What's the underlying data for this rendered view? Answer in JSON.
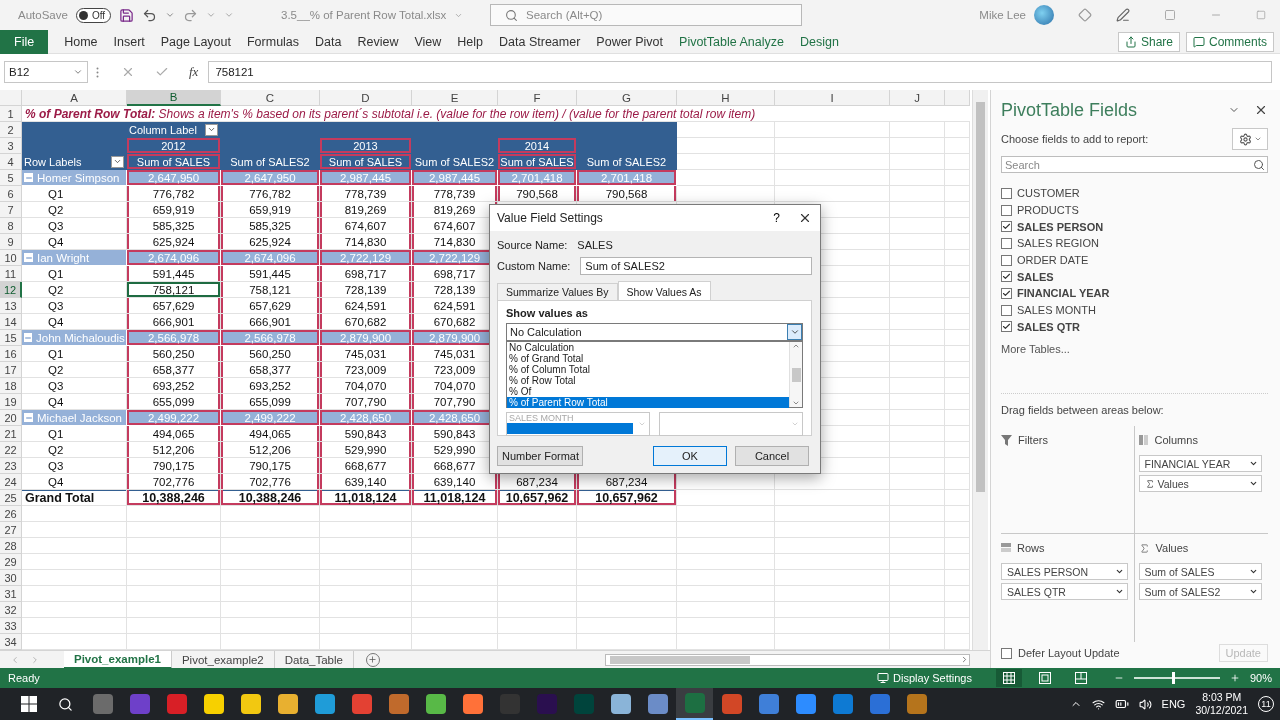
{
  "title_bar": {
    "autosave_label": "AutoSave",
    "autosave_state": "Off",
    "autosave_on": false,
    "file_name": "3.5__% of Parent Row Total.xlsx",
    "search_placeholder": "Search (Alt+Q)",
    "user_name": "Mike Lee"
  },
  "ribbon": {
    "tabs": [
      {
        "label": "File",
        "kind": "file"
      },
      {
        "label": "Home",
        "kind": "normal"
      },
      {
        "label": "Insert",
        "kind": "normal"
      },
      {
        "label": "Page Layout",
        "kind": "normal"
      },
      {
        "label": "Formulas",
        "kind": "normal"
      },
      {
        "label": "Data",
        "kind": "normal"
      },
      {
        "label": "Review",
        "kind": "normal"
      },
      {
        "label": "View",
        "kind": "normal"
      },
      {
        "label": "Help",
        "kind": "normal"
      },
      {
        "label": "Data Streamer",
        "kind": "normal"
      },
      {
        "label": "Power Pivot",
        "kind": "normal"
      },
      {
        "label": "PivotTable Analyze",
        "kind": "contextual"
      },
      {
        "label": "Design",
        "kind": "contextual"
      }
    ],
    "share": "Share",
    "comments": "Comments"
  },
  "formula_bar": {
    "name_box": "B12",
    "fx": "fx",
    "value": "758121"
  },
  "sheet": {
    "columns": [
      {
        "label": "A",
        "selected": false
      },
      {
        "label": "B",
        "selected": true
      },
      {
        "label": "C",
        "selected": false
      },
      {
        "label": "D",
        "selected": false
      },
      {
        "label": "E",
        "selected": false
      },
      {
        "label": "F",
        "selected": false
      },
      {
        "label": "G",
        "selected": false
      },
      {
        "label": "H",
        "selected": false
      },
      {
        "label": "I",
        "selected": false
      },
      {
        "label": "J",
        "selected": false
      }
    ],
    "row_numbers": [
      "1",
      "2",
      "3",
      "4",
      "5",
      "6",
      "7",
      "8",
      "9",
      "10",
      "11",
      "12",
      "13",
      "14",
      "15",
      "16",
      "17",
      "18",
      "19",
      "20",
      "21",
      "22",
      "23",
      "24",
      "25",
      "26",
      "27",
      "28",
      "29",
      "30",
      "31",
      "32",
      "33",
      "34"
    ],
    "note": "**% of Parent Row Total:**  Shows a item's % based on its parent´s subtotal i.e. (value for the row item) / (value for the parent total row item)",
    "pivot": {
      "column_labels": "Column Label",
      "row_labels": "Row Labels",
      "years": [
        "2012",
        "2013",
        "2014"
      ],
      "value_headers": [
        "Sum of SALES",
        "Sum of SALES2",
        "Sum of SALES",
        "Sum of SALES2",
        "Sum of SALES",
        "Sum of SALES2"
      ],
      "groups": [
        {
          "name": "Homer Simpson",
          "expanded": true,
          "totals": [
            "2,647,950",
            "2,647,950",
            "2,987,445",
            "2,987,445",
            "2,701,418",
            "2,701,418"
          ],
          "quarters": [
            {
              "label": "Q1",
              "selected": false,
              "values": [
                "776,782",
                "776,782",
                "778,739",
                "778,739",
                "790,568",
                "790,568"
              ]
            },
            {
              "label": "Q2",
              "selected": false,
              "values": [
                "659,919",
                "659,919",
                "819,269",
                "819,269"
              ]
            },
            {
              "label": "Q3",
              "selected": false,
              "values": [
                "585,325",
                "585,325",
                "674,607",
                "674,607"
              ]
            },
            {
              "label": "Q4",
              "selected": false,
              "values": [
                "625,924",
                "625,924",
                "714,830",
                "714,830"
              ]
            }
          ]
        },
        {
          "name": "Ian Wright",
          "expanded": true,
          "totals": [
            "2,674,096",
            "2,674,096",
            "2,722,129",
            "2,722,129"
          ],
          "quarters": [
            {
              "label": "Q1",
              "selected": false,
              "values": [
                "591,445",
                "591,445",
                "698,717",
                "698,717"
              ]
            },
            {
              "label": "Q2",
              "selected": true,
              "values": [
                "758,121",
                "758,121",
                "728,139",
                "728,139"
              ]
            },
            {
              "label": "Q3",
              "selected": false,
              "values": [
                "657,629",
                "657,629",
                "624,591",
                "624,591"
              ]
            },
            {
              "label": "Q4",
              "selected": false,
              "values": [
                "666,901",
                "666,901",
                "670,682",
                "670,682"
              ]
            }
          ]
        },
        {
          "name": "John Michaloudis",
          "expanded": true,
          "totals": [
            "2,566,978",
            "2,566,978",
            "2,879,900",
            "2,879,900"
          ],
          "quarters": [
            {
              "label": "Q1",
              "selected": false,
              "values": [
                "560,250",
                "560,250",
                "745,031",
                "745,031"
              ]
            },
            {
              "label": "Q2",
              "selected": false,
              "values": [
                "658,377",
                "658,377",
                "723,009",
                "723,009"
              ]
            },
            {
              "label": "Q3",
              "selected": false,
              "values": [
                "693,252",
                "693,252",
                "704,070",
                "704,070"
              ]
            },
            {
              "label": "Q4",
              "selected": false,
              "values": [
                "655,099",
                "655,099",
                "707,790",
                "707,790"
              ]
            }
          ]
        },
        {
          "name": "Michael Jackson",
          "expanded": true,
          "totals": [
            "2,499,222",
            "2,499,222",
            "2,428,650",
            "2,428,650"
          ],
          "quarters": [
            {
              "label": "Q1",
              "selected": false,
              "values": [
                "494,065",
                "494,065",
                "590,843",
                "590,843"
              ]
            },
            {
              "label": "Q2",
              "selected": false,
              "values": [
                "512,206",
                "512,206",
                "529,990",
                "529,990"
              ]
            },
            {
              "label": "Q3",
              "selected": false,
              "values": [
                "790,175",
                "790,175",
                "668,677",
                "668,677"
              ]
            },
            {
              "label": "Q4",
              "selected": false,
              "values": [
                "702,776",
                "702,776",
                "639,140",
                "639,140",
                "687,234",
                "687,234"
              ]
            }
          ]
        }
      ],
      "grand_total": {
        "label": "Grand Total",
        "values": [
          "10,388,246",
          "10,388,246",
          "11,018,124",
          "11,018,124",
          "10,657,962",
          "10,657,962"
        ]
      }
    }
  },
  "dialog": {
    "title": "Value Field Settings",
    "help": "?",
    "source_label": "Source Name:",
    "source_value": "SALES",
    "custom_label": "Custom Name:",
    "custom_value": "Sum of SALES2",
    "tabs": [
      {
        "label": "Summarize Values By",
        "selected": false
      },
      {
        "label": "Show Values As",
        "selected": true
      }
    ],
    "section_label": "Show values as",
    "dropdown_value": "No Calculation",
    "options": [
      {
        "label": "No Calculation",
        "selected": false
      },
      {
        "label": "% of Grand Total",
        "selected": false
      },
      {
        "label": "% of Column Total",
        "selected": false
      },
      {
        "label": "% of Row Total",
        "selected": false
      },
      {
        "label": "% Of",
        "selected": false
      },
      {
        "label": "% of Parent Row Total",
        "selected": true
      }
    ],
    "base_field_item": "SALES MONTH",
    "buttons": [
      {
        "label": "Number Format",
        "kind": "secondary"
      },
      {
        "label": "OK",
        "kind": "default"
      },
      {
        "label": "Cancel",
        "kind": "secondary"
      }
    ]
  },
  "pane": {
    "title": "PivotTable Fields",
    "subtitle": "Choose fields to add to report:",
    "search_placeholder": "Search",
    "fields": [
      {
        "label": "CUSTOMER",
        "checked": false
      },
      {
        "label": "PRODUCTS",
        "checked": false
      },
      {
        "label": "SALES PERSON",
        "checked": true
      },
      {
        "label": "SALES REGION",
        "checked": false
      },
      {
        "label": "ORDER DATE",
        "checked": false
      },
      {
        "label": "SALES",
        "checked": true
      },
      {
        "label": "FINANCIAL YEAR",
        "checked": true
      },
      {
        "label": "SALES MONTH",
        "checked": false
      },
      {
        "label": "SALES QTR",
        "checked": true
      }
    ],
    "more_tables": "More Tables...",
    "drag_hint": "Drag fields between areas below:",
    "areas": [
      {
        "title": "Filters",
        "kind": "filters"
      },
      {
        "title": "Columns",
        "kind": "columns",
        "items": [
          {
            "label": "FINANCIAL YEAR",
            "kind": "field"
          },
          {
            "label": "Values",
            "kind": "values"
          }
        ]
      },
      {
        "title": "Rows",
        "kind": "rows",
        "items": [
          {
            "label": "SALES PERSON",
            "kind": "field"
          },
          {
            "label": "SALES QTR",
            "kind": "field"
          }
        ]
      },
      {
        "title": "Values",
        "kind": "values",
        "items": [
          {
            "label": "Sum of SALES",
            "kind": "field"
          },
          {
            "label": "Sum of SALES2",
            "kind": "field"
          }
        ]
      }
    ],
    "defer_label": "Defer Layout Update",
    "defer_checked": false,
    "update": "Update",
    "update_disabled": true
  },
  "sheet_tabs": {
    "tabs": [
      {
        "label": "Pivot_example1",
        "selected": true
      },
      {
        "label": "Pivot_example2",
        "selected": false
      },
      {
        "label": "Data_Table",
        "selected": false
      }
    ]
  },
  "status_bar": {
    "status": "Ready",
    "display_settings": "Display Settings",
    "views": [
      {
        "kind": "normal",
        "selected": true
      },
      {
        "kind": "page_layout",
        "selected": false
      },
      {
        "kind": "page_break",
        "selected": false
      }
    ],
    "zoom": {
      "level": 0.45,
      "reading": "90%"
    }
  },
  "taskbar": {
    "apps": [
      {
        "color": "#6b6b6b",
        "active": false
      },
      {
        "color": "#6e40c9",
        "active": false
      },
      {
        "color": "#d81f26",
        "active": false
      },
      {
        "color": "#f7d000",
        "active": false
      },
      {
        "color": "#f2c811",
        "active": false
      },
      {
        "color": "#e8b030",
        "active": false
      },
      {
        "color": "#1f9cd8",
        "active": false
      },
      {
        "color": "#e34133",
        "active": false
      },
      {
        "color": "#c06a2c",
        "active": false
      },
      {
        "color": "#58b947",
        "active": false
      },
      {
        "color": "#ff7139",
        "active": false
      },
      {
        "color": "#333333",
        "active": false
      },
      {
        "color": "#2a0f4f",
        "active": false
      },
      {
        "color": "#00443c",
        "active": false
      },
      {
        "color": "#8ab4d8",
        "active": false
      },
      {
        "color": "#6b8cc7",
        "active": false
      },
      {
        "color": "#1d6f42",
        "active": true
      },
      {
        "color": "#d24726",
        "active": false
      },
      {
        "color": "#3f7fd8",
        "active": false
      },
      {
        "color": "#2d8cff",
        "active": false
      },
      {
        "color": "#0e7ad3",
        "active": false
      },
      {
        "color": "#2b6fd6",
        "active": false
      },
      {
        "color": "#b5741c",
        "active": false
      }
    ],
    "language": "ENG",
    "time": "8:03 PM",
    "date": "30/12/2021",
    "notifications": "11"
  }
}
